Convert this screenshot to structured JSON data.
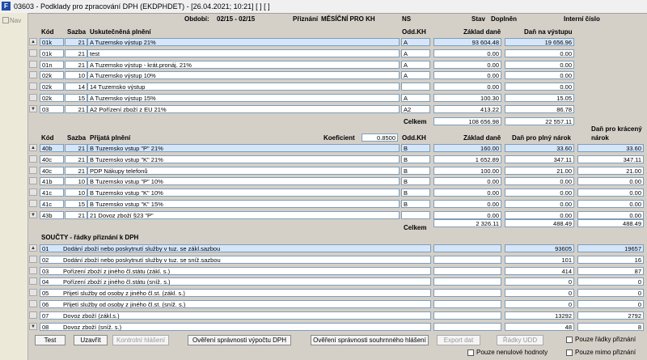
{
  "window": {
    "title": "03603 - Podklady pro zpracování DPH (EKDPHDET) - [26.04.2021; 10:21] [ ] [ ]",
    "nav_label": "Nav"
  },
  "header": {
    "obdobi_label": "Období:",
    "obdobi_value": "02/15 - 02/15",
    "priznani_label": "Přiznání",
    "priznani_value": "MĚSÍČNÍ PRO KH",
    "ns_label": "NS",
    "stav_label": "Stav",
    "stav_value": "Doplněn",
    "interni_label": "Interní číslo"
  },
  "output": {
    "headers": {
      "kod": "Kód",
      "sazba": "Sazba",
      "plneni": "Uskutečněná plnění",
      "oddkh": "Odd.KH",
      "zaklad": "Základ daně",
      "dan": "Daň na výstupu"
    },
    "rows": [
      {
        "kod": "01k",
        "sazba": "21",
        "plneni": "A Tuzemsko výstup 21%",
        "oddkh": "A",
        "zaklad": "93 604.48",
        "dan": "19 656.96"
      },
      {
        "kod": "01k",
        "sazba": "21",
        "plneni": "test",
        "oddkh": "A",
        "zaklad": "0.00",
        "dan": "0.00"
      },
      {
        "kod": "01n",
        "sazba": "21",
        "plneni": "A Tuzemsko výstup - krát.pronáj. 21%",
        "oddkh": "A",
        "zaklad": "0.00",
        "dan": "0.00"
      },
      {
        "kod": "02k",
        "sazba": "10",
        "plneni": "A Tuzemsko výstup 10%",
        "oddkh": "A",
        "zaklad": "0.00",
        "dan": "0.00"
      },
      {
        "kod": "02k",
        "sazba": "14",
        "plneni": "14 Tuzemsko výstup",
        "oddkh": "",
        "zaklad": "0.00",
        "dan": "0.00"
      },
      {
        "kod": "02k",
        "sazba": "15",
        "plneni": "A Tuzemsko výstup 15%",
        "oddkh": "A",
        "zaklad": "100.30",
        "dan": "15.05"
      },
      {
        "kod": "03",
        "sazba": "21",
        "plneni": "A2 Pořízení zboží z EU 21%",
        "oddkh": "A2",
        "zaklad": "413.22",
        "dan": "86.78"
      }
    ],
    "celkem_label": "Celkem",
    "celkem_zaklad": "108 656.98",
    "celkem_dan": "22 557.11"
  },
  "input": {
    "headers": {
      "kod": "Kód",
      "sazba": "Sazba",
      "plneni": "Přijatá plnění",
      "koef_label": "Koeficient",
      "koef_value": "0.8500",
      "oddkh": "Odd.KH",
      "zaklad": "Základ daně",
      "plny": "Daň pro plný nárok",
      "kraceny1": "Daň pro krácený",
      "kraceny2": "nárok"
    },
    "rows": [
      {
        "kod": "40b",
        "sazba": "21",
        "plneni": "B Tuzemsko vstup \"P\" 21%",
        "oddkh": "B",
        "zaklad": "160.00",
        "plny": "33.60",
        "kraceny": "33.60"
      },
      {
        "kod": "40c",
        "sazba": "21",
        "plneni": "B Tuzemsko vstup \"K\" 21%",
        "oddkh": "B",
        "zaklad": "1 652.89",
        "plny": "347.11",
        "kraceny": "347.11"
      },
      {
        "kod": "40c",
        "sazba": "21",
        "plneni": "PDP Nákupy telefonů",
        "oddkh": "B",
        "zaklad": "100.00",
        "plny": "21.00",
        "kraceny": "21.00"
      },
      {
        "kod": "41b",
        "sazba": "10",
        "plneni": "B Tuzemsko vstup \"P\" 10%",
        "oddkh": "B",
        "zaklad": "0.00",
        "plny": "0.00",
        "kraceny": "0.00"
      },
      {
        "kod": "41c",
        "sazba": "10",
        "plneni": "B Tuzemsko vstup \"K\" 10%",
        "oddkh": "B",
        "zaklad": "0.00",
        "plny": "0.00",
        "kraceny": "0.00"
      },
      {
        "kod": "41c",
        "sazba": "15",
        "plneni": "B Tuzemsko vstup \"K\" 15%",
        "oddkh": "B",
        "zaklad": "0.00",
        "plny": "0.00",
        "kraceny": "0.00"
      },
      {
        "kod": "43b",
        "sazba": "21",
        "plneni": "21 Dovoz zboží §23 \"P\"",
        "oddkh": "",
        "zaklad": "0.00",
        "plny": "0.00",
        "kraceny": "0.00"
      }
    ],
    "celkem_label": "Celkem",
    "celkem_zaklad": "2 326.11",
    "celkem_plny": "488.49",
    "celkem_kraceny": "488.49"
  },
  "souhrn": {
    "title": "SOUČTY - řádky přiznání k DPH",
    "rows": [
      {
        "kod": "01",
        "popis": "Dodání zboží nebo poskytnutí služby v tuz. se zákl.sazbou",
        "zaklad": "93605",
        "dan": "19657"
      },
      {
        "kod": "02",
        "popis": "Dodání zboží nebo poskytnutí služby v tuz. se sníž.sazbou",
        "zaklad": "101",
        "dan": "16"
      },
      {
        "kod": "03",
        "popis": "Pořízení zboží z jiného čl.státu (zákl. s.)",
        "zaklad": "414",
        "dan": "87"
      },
      {
        "kod": "04",
        "popis": "Pořízení zboží z jiného čl.státu (sníž. s.)",
        "zaklad": "0",
        "dan": "0"
      },
      {
        "kod": "05",
        "popis": "Přijetí služby od osoby z jiného čl.st. (zákl. s.)",
        "zaklad": "0",
        "dan": "0"
      },
      {
        "kod": "06",
        "popis": "Přijetí služby od osoby z jiného čl.st. (sníž. s.)",
        "zaklad": "0",
        "dan": "0"
      },
      {
        "kod": "07",
        "popis": "Dovoz zboží (zákl.s.)",
        "zaklad": "13292",
        "dan": "2792"
      },
      {
        "kod": "08",
        "popis": "Dovoz zboží (sníž. s.)",
        "zaklad": "48",
        "dan": "8"
      }
    ]
  },
  "buttons": {
    "test": "Test",
    "uzavrit": "Uzavřít",
    "kontrolni": "Kontrolní hlášení",
    "overeni_dph": "Ověření správnosti výpočtu DPH",
    "overeni_souhrn": "Ověření správnosti souhrnného hlášení",
    "export": "Export dat",
    "radky_udd": "Řádky UDD"
  },
  "checkboxes": {
    "pouze_radky": "Pouze řádky přiznání",
    "pouze_nenulove": "Pouze nenulové hodnoty",
    "pouze_mimo": "Pouze mimo přiznání"
  }
}
